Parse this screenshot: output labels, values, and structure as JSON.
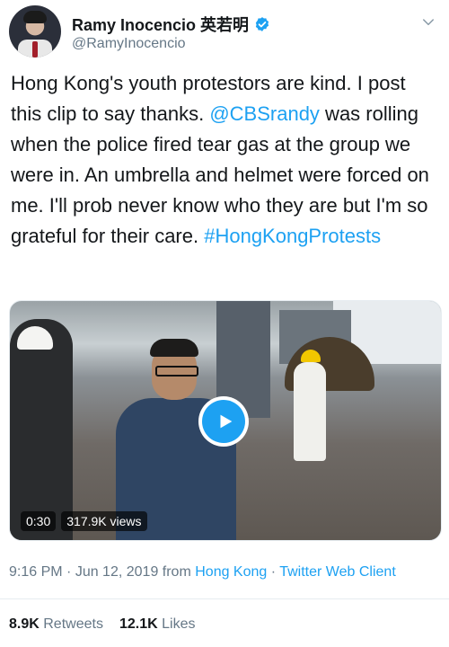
{
  "author": {
    "display_name": "Ramy Inocencio 英若明",
    "handle": "@RamyInocencio"
  },
  "tweet": {
    "text_part1": "Hong Kong's youth protestors are kind. I post this clip to say thanks. ",
    "mention": "@CBSrandy",
    "text_part2": " was rolling when the police fired tear gas at the group we were in.  An umbrella and helmet were forced on me. I'll prob never know who they are but I'm so grateful for their care. ",
    "hashtag": "#HongKongProtests"
  },
  "video": {
    "duration": "0:30",
    "views": "317.9K views"
  },
  "meta": {
    "time": "9:16 PM",
    "sep1": " · ",
    "date": "Jun 12, 2019 from ",
    "location": "Hong Kong",
    "sep2": " · ",
    "client": "Twitter Web Client"
  },
  "stats": {
    "retweets_value": "8.9K",
    "retweets_label": "Retweets",
    "likes_value": "12.1K",
    "likes_label": "Likes"
  },
  "colors": {
    "accent": "#1da1f2",
    "muted": "#657786",
    "text": "#14171a"
  },
  "icons": {
    "verified": "verified-badge-icon",
    "more": "chevron-down-icon",
    "play": "play-icon"
  }
}
